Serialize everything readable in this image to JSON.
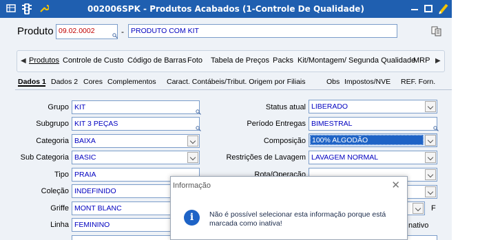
{
  "window": {
    "title": "002006SPK - Produtos Acabados (1-Controle De Qualidade)",
    "icons": [
      "grid-icon",
      "traffic-light-icon",
      "wrench-icon",
      "minimize-icon",
      "maximize-icon",
      "pencil-icon"
    ]
  },
  "product": {
    "label": "Produto",
    "code": "09.02.0002",
    "separator": "-",
    "name": "PRODUTO COM KIT"
  },
  "tabs": [
    "Produtos",
    "Controle de Custo",
    "Código de Barras",
    "Foto",
    "Tabela de Preços",
    "Packs",
    "Kit/Montagem/ Segunda Qualidade",
    "MRP"
  ],
  "active_tab": "Produtos",
  "subtabs": [
    "Dados 1",
    "Dados 2",
    "Cores",
    "Complementos",
    "Caract. Contábeis/Tribut. Origem por Filiais",
    "Obs",
    "Impostos/NVE",
    "REF. Forn."
  ],
  "left_fields": [
    {
      "label": "Grupo",
      "value": "KIT"
    },
    {
      "label": "Subgrupo",
      "value": "KIT 3 PEÇAS"
    },
    {
      "label": "Categoria",
      "value": "BAIXA"
    },
    {
      "label": "Sub Categoria",
      "value": "BASIC"
    },
    {
      "label": "Tipo",
      "value": "PRAIA"
    },
    {
      "label": "Coleção",
      "value": "INDEFINIDO"
    },
    {
      "label": "Griffe",
      "value": "MONT BLANC"
    },
    {
      "label": "Linha",
      "value": "FEMININO"
    }
  ],
  "right_fields": [
    {
      "label": "Status atual",
      "value": "LIBERADO"
    },
    {
      "label": "Período Entregas",
      "value": "BIMESTRAL"
    },
    {
      "label": "Composição",
      "value": "100% ALGODÃO"
    },
    {
      "label": "Restrições de Lavagem",
      "value": "LAVAGEM NORMAL"
    },
    {
      "label": "Rota/Operação",
      "value": ""
    }
  ],
  "partial": {
    "f": "F",
    "inativo": "nativo"
  },
  "dialog": {
    "title": "Informação",
    "close": "✕",
    "icon": "i",
    "message": "Não é possível selecionar esta informação porque está marcada como inativa!"
  },
  "colors": {
    "titlebar": "#1f5fb0",
    "value_text": "#0000c0",
    "code_text": "#c00000",
    "selected": "#1e63c6"
  }
}
